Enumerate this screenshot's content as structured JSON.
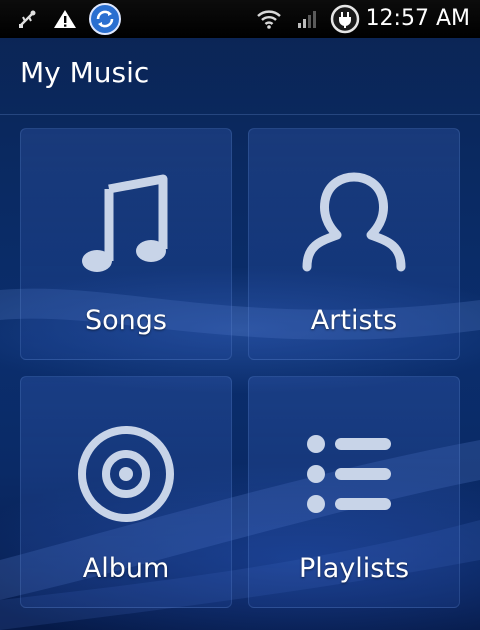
{
  "status_bar": {
    "time": "12:57 AM",
    "icons": [
      "usb-debug-icon",
      "warning-icon",
      "sync-icon",
      "wifi-icon",
      "signal-icon",
      "charging-icon"
    ]
  },
  "header": {
    "title": "My Music"
  },
  "tiles": [
    {
      "label": "Songs",
      "icon": "music-note-icon"
    },
    {
      "label": "Artists",
      "icon": "person-icon"
    },
    {
      "label": "Album",
      "icon": "disc-icon"
    },
    {
      "label": "Playlists",
      "icon": "list-icon"
    }
  ],
  "colors": {
    "background": "#0a2a63",
    "icon": "#c8d4e8",
    "text": "#ffffff"
  }
}
